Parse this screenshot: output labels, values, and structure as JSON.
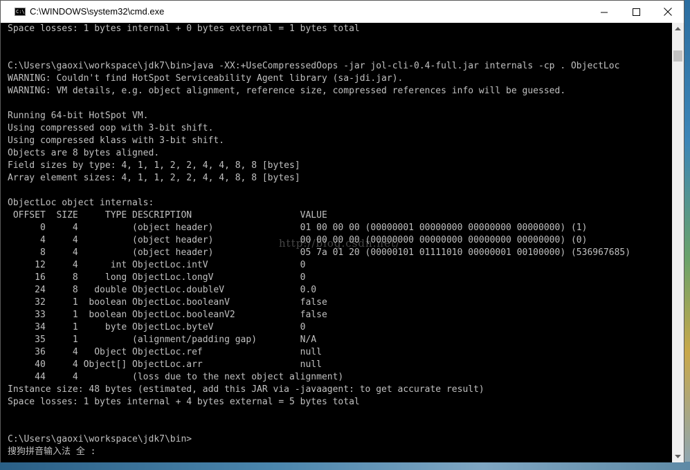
{
  "window": {
    "title": "C:\\WINDOWS\\system32\\cmd.exe",
    "icon_label": "C:\\"
  },
  "console": {
    "lines": [
      "Space losses: 1 bytes internal + 0 bytes external = 1 bytes total",
      "",
      "",
      "C:\\Users\\gaoxi\\workspace\\jdk7\\bin>java -XX:+UseCompressedOops -jar jol-cli-0.4-full.jar internals -cp . ObjectLoc",
      "WARNING: Couldn't find HotSpot Serviceability Agent library (sa-jdi.jar).",
      "WARNING: VM details, e.g. object alignment, reference size, compressed references info will be guessed.",
      "",
      "Running 64-bit HotSpot VM.",
      "Using compressed oop with 3-bit shift.",
      "Using compressed klass with 3-bit shift.",
      "Objects are 8 bytes aligned.",
      "Field sizes by type: 4, 1, 1, 2, 2, 4, 4, 8, 8 [bytes]",
      "Array element sizes: 4, 1, 1, 2, 2, 4, 4, 8, 8 [bytes]",
      "",
      "ObjectLoc object internals:",
      " OFFSET  SIZE     TYPE DESCRIPTION                    VALUE",
      "      0     4          (object header)                01 00 00 00 (00000001 00000000 00000000 00000000) (1)",
      "      4     4          (object header)                00 00 00 00 (00000000 00000000 00000000 00000000) (0)",
      "      8     4          (object header)                05 7a 01 20 (00000101 01111010 00000001 00100000) (536967685)",
      "     12     4      int ObjectLoc.intV                 0",
      "     16     8     long ObjectLoc.longV                0",
      "     24     8   double ObjectLoc.doubleV              0.0",
      "     32     1  boolean ObjectLoc.booleanV             false",
      "     33     1  boolean ObjectLoc.booleanV2            false",
      "     34     1     byte ObjectLoc.byteV                0",
      "     35     1          (alignment/padding gap)        N/A",
      "     36     4   Object ObjectLoc.ref                  null",
      "     40     4 Object[] ObjectLoc.arr                  null",
      "     44     4          (loss due to the next object alignment)",
      "Instance size: 48 bytes (estimated, add this JAR via -javaagent: to get accurate result)",
      "Space losses: 1 bytes internal + 4 bytes external = 5 bytes total",
      "",
      "",
      "C:\\Users\\gaoxi\\workspace\\jdk7\\bin>",
      "搜狗拼音输入法 全 :"
    ],
    "watermark": "http://blog.csdn.net/"
  },
  "colors": {
    "console_bg": "#000000",
    "console_fg": "#c0c0c0",
    "titlebar_bg": "#ffffff"
  }
}
